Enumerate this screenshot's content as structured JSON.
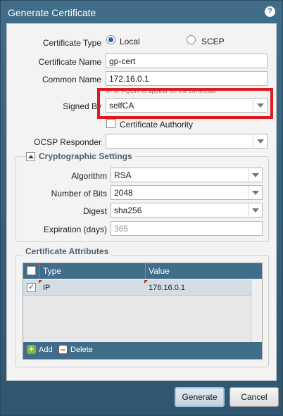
{
  "dialog": {
    "title": "Generate Certificate",
    "help_icon": "?"
  },
  "form": {
    "certificate_type_label": "Certificate Type",
    "type_local": "Local",
    "type_scep": "SCEP",
    "type_selected": "Local",
    "certificate_name_label": "Certificate Name",
    "certificate_name_value": "gp-cert",
    "common_name_label": "Common Name",
    "common_name_value": "172.16.0.1",
    "common_name_hint": "IP or FQDN to appear on the certificate",
    "signed_by_label": "Signed By",
    "signed_by_value": "selfCA",
    "certificate_authority_label": "Certificate Authority",
    "certificate_authority_checked": false,
    "ocsp_responder_label": "OCSP Responder",
    "ocsp_responder_value": ""
  },
  "crypto": {
    "section_title": "Cryptographic Settings",
    "algorithm_label": "Algorithm",
    "algorithm_value": "RSA",
    "bits_label": "Number of Bits",
    "bits_value": "2048",
    "digest_label": "Digest",
    "digest_value": "sha256",
    "expiration_label": "Expiration (days)",
    "expiration_value": "365"
  },
  "attributes": {
    "section_title": "Certificate Attributes",
    "columns": [
      "Type",
      "Value"
    ],
    "rows": [
      {
        "checked": true,
        "type": "IP",
        "value": "176.16.0.1"
      }
    ],
    "add_label": "Add",
    "delete_label": "Delete"
  },
  "buttons": {
    "generate": "Generate",
    "cancel": "Cancel"
  },
  "colors": {
    "titlebar": "#3f6d8a",
    "highlight": "#e0191b"
  }
}
